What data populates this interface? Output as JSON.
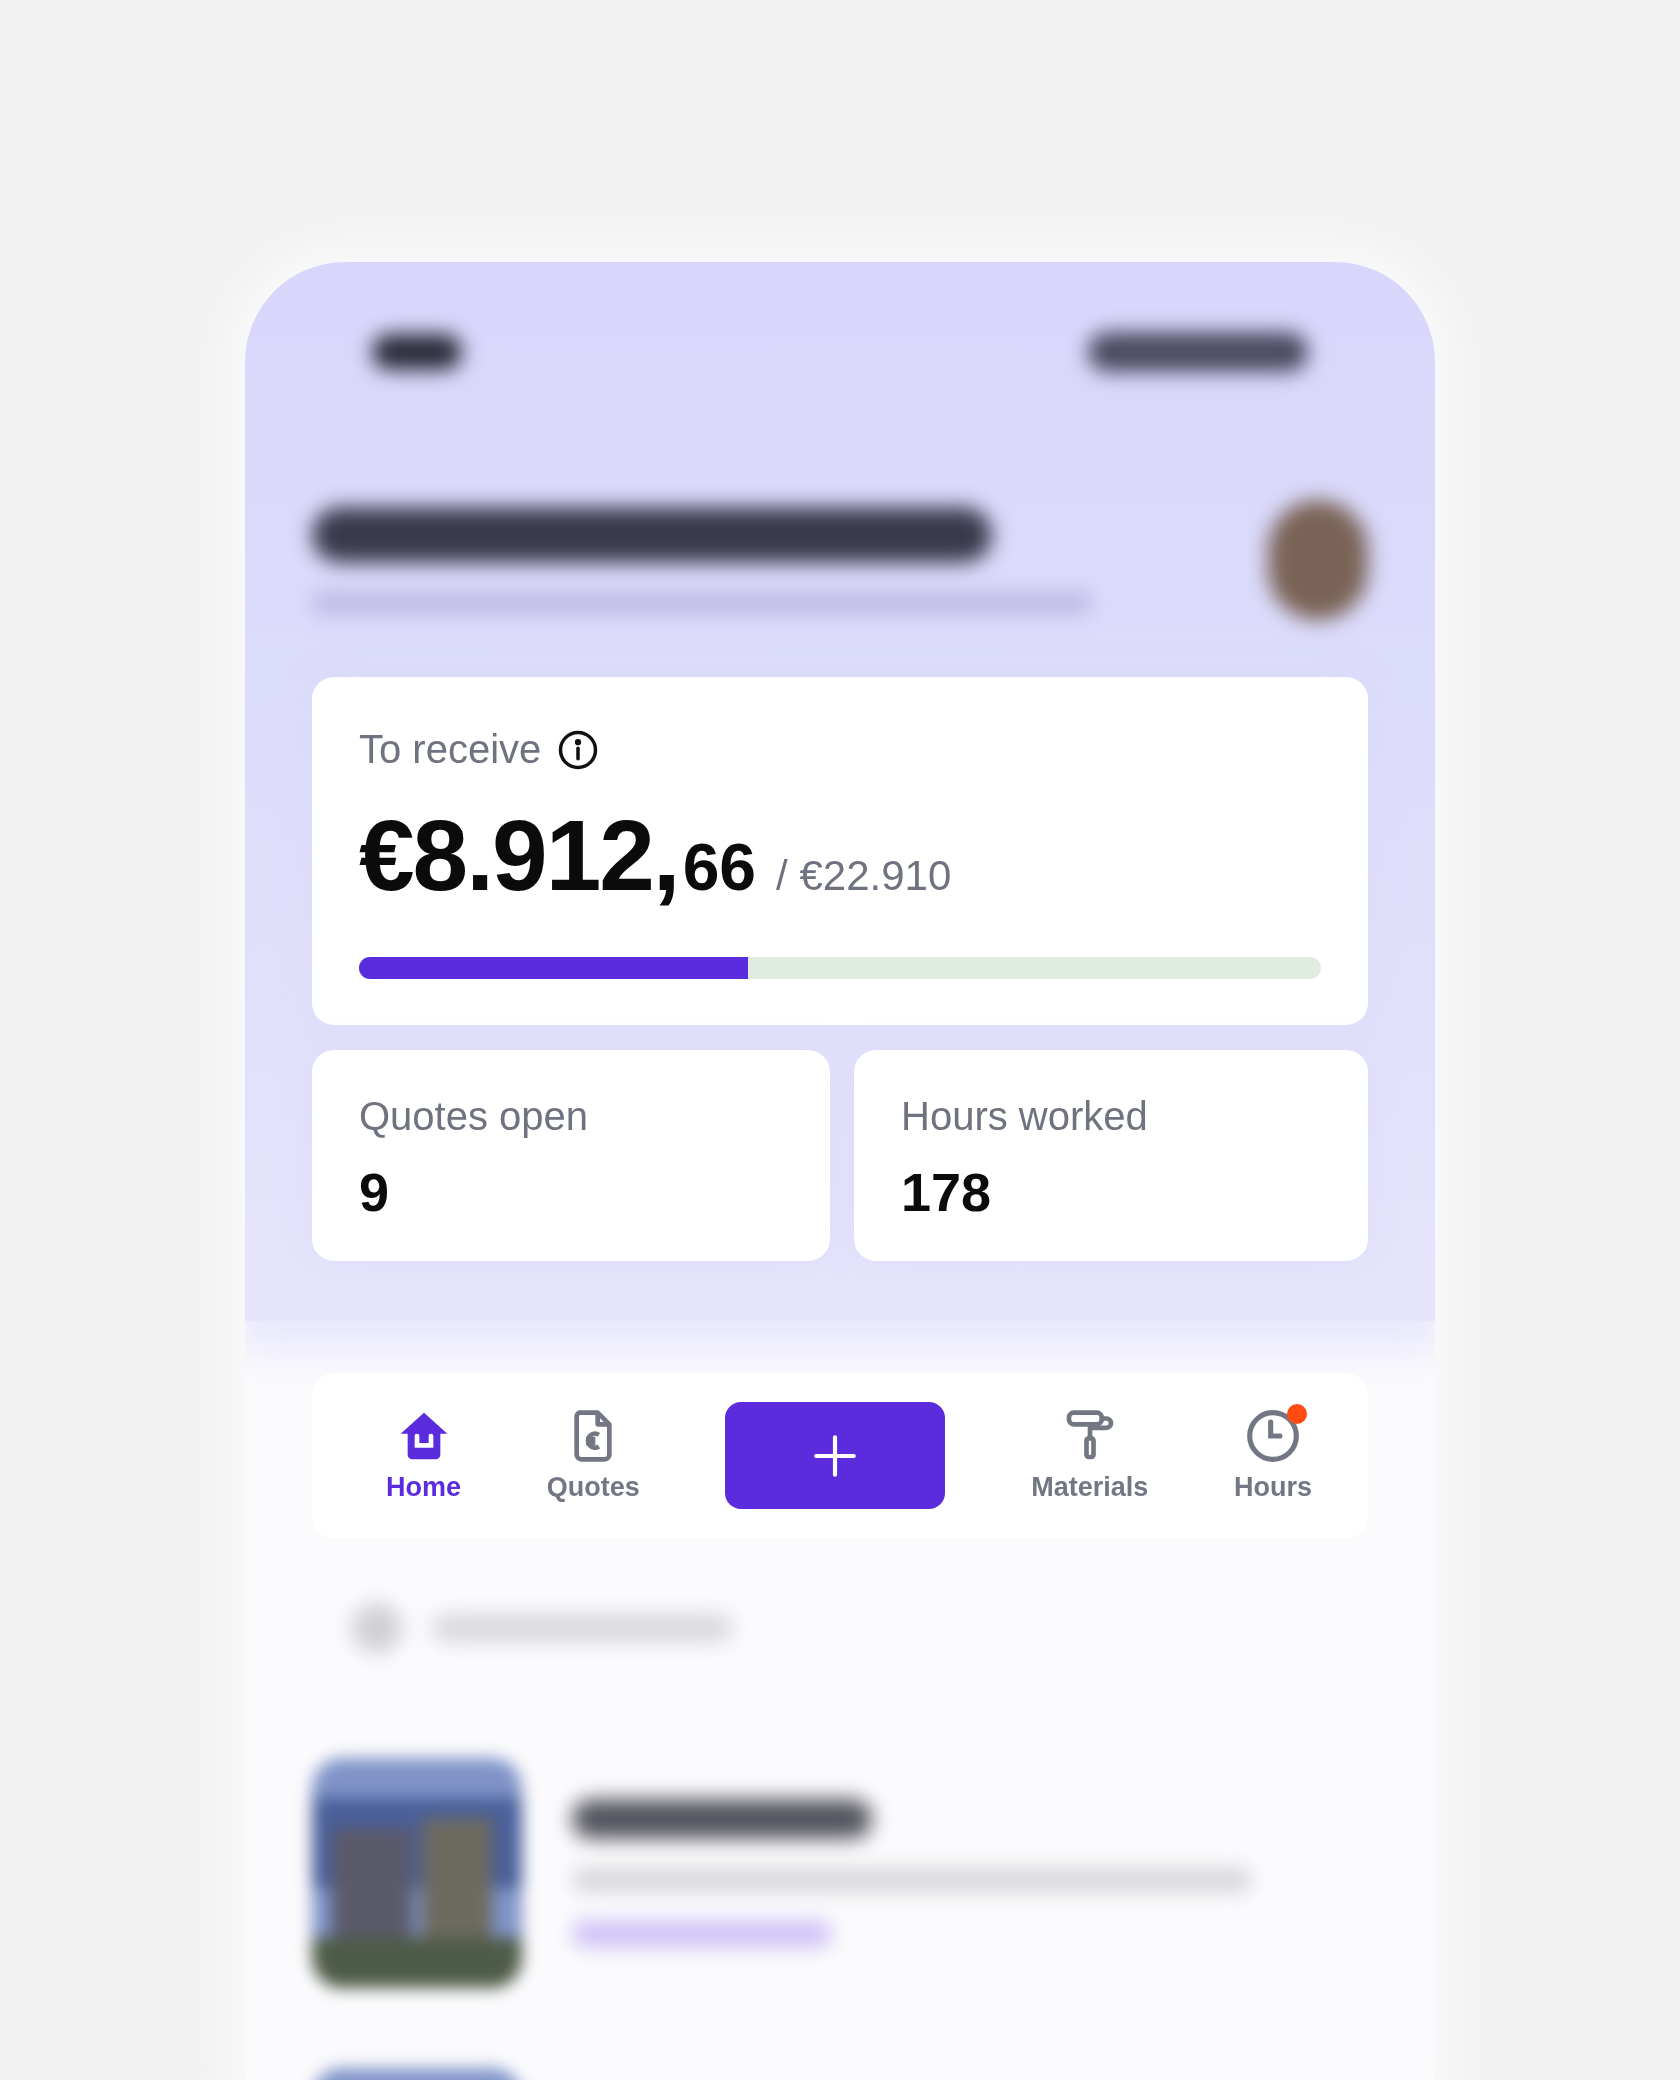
{
  "balance": {
    "label": "To receive",
    "amount_main": "€8.912,",
    "amount_cents": "66",
    "total": "/ €22.910",
    "level": 0.404
  },
  "stats": [
    {
      "label": "Quotes open",
      "value": "9"
    },
    {
      "label": "Hours worked",
      "value": "178"
    }
  ],
  "nav": [
    {
      "kind": "tab",
      "label": "Home",
      "selected": true,
      "badge": false
    },
    {
      "kind": "tab",
      "label": "Quotes",
      "selected": false,
      "badge": false
    },
    {
      "kind": "add"
    },
    {
      "kind": "tab",
      "label": "Materials",
      "selected": false,
      "badge": false
    },
    {
      "kind": "tab",
      "label": "Hours",
      "selected": false,
      "badge": true
    }
  ]
}
